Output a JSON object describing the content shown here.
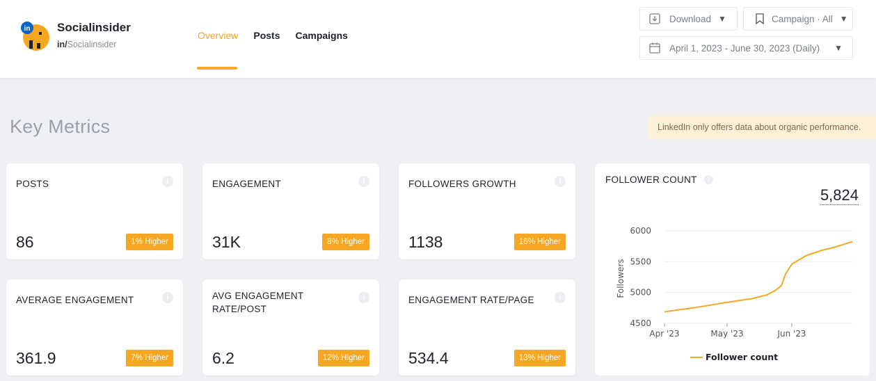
{
  "brand": {
    "name": "Socialinsider",
    "handle_prefix": "in/",
    "handle": "Socialinsider",
    "badge": "in"
  },
  "nav": {
    "items": [
      {
        "label": "Overview",
        "active": true
      },
      {
        "label": "Posts"
      },
      {
        "label": "Campaigns"
      }
    ]
  },
  "toolbar": {
    "download_label": "Download",
    "campaign_label": "Campaign · All",
    "date_range": "April 1, 2023 - June 30, 2023 (Daily)"
  },
  "section_title": "Key Metrics",
  "notice": "LinkedIn only offers data about organic performance.",
  "colors": {
    "accent": "#f5a623",
    "notice_bg": "#fdf1d8"
  },
  "metrics": [
    {
      "label": "POSTS",
      "value": "86",
      "badge": "1% Higher"
    },
    {
      "label": "ENGAGEMENT",
      "value": "31K",
      "badge": "8% Higher"
    },
    {
      "label": "FOLLOWERS GROWTH",
      "value": "1138",
      "badge": "16% Higher"
    },
    {
      "label": "AVERAGE ENGAGEMENT",
      "value": "361.9",
      "badge": "7% Higher"
    },
    {
      "label": "AVG ENGAGEMENT RATE/POST",
      "value": "6.2",
      "badge": "12% Higher"
    },
    {
      "label": "ENGAGEMENT RATE/PAGE",
      "value": "534.4",
      "badge": "13% Higher"
    }
  ],
  "follower_card": {
    "title": "FOLLOWER COUNT",
    "total": "5,824"
  },
  "chart_data": {
    "type": "line",
    "ylabel": "Followers",
    "ylim": [
      4500,
      6000
    ],
    "yticks": [
      "4500",
      "5000",
      "5500",
      "6000"
    ],
    "xtick_labels": [
      "Apr '23",
      "May '23",
      "Jun '23"
    ],
    "legend": "Follower count",
    "grid": true,
    "series": [
      {
        "name": "Follower count",
        "x": [
          "2023-04-01",
          "2023-04-08",
          "2023-04-15",
          "2023-04-22",
          "2023-04-29",
          "2023-05-06",
          "2023-05-13",
          "2023-05-20",
          "2023-05-24",
          "2023-05-27",
          "2023-05-29",
          "2023-06-01",
          "2023-06-08",
          "2023-06-15",
          "2023-06-22",
          "2023-06-30"
        ],
        "values": [
          4686,
          4720,
          4752,
          4790,
          4830,
          4865,
          4900,
          4960,
          5030,
          5110,
          5300,
          5460,
          5600,
          5680,
          5740,
          5824
        ]
      }
    ]
  }
}
